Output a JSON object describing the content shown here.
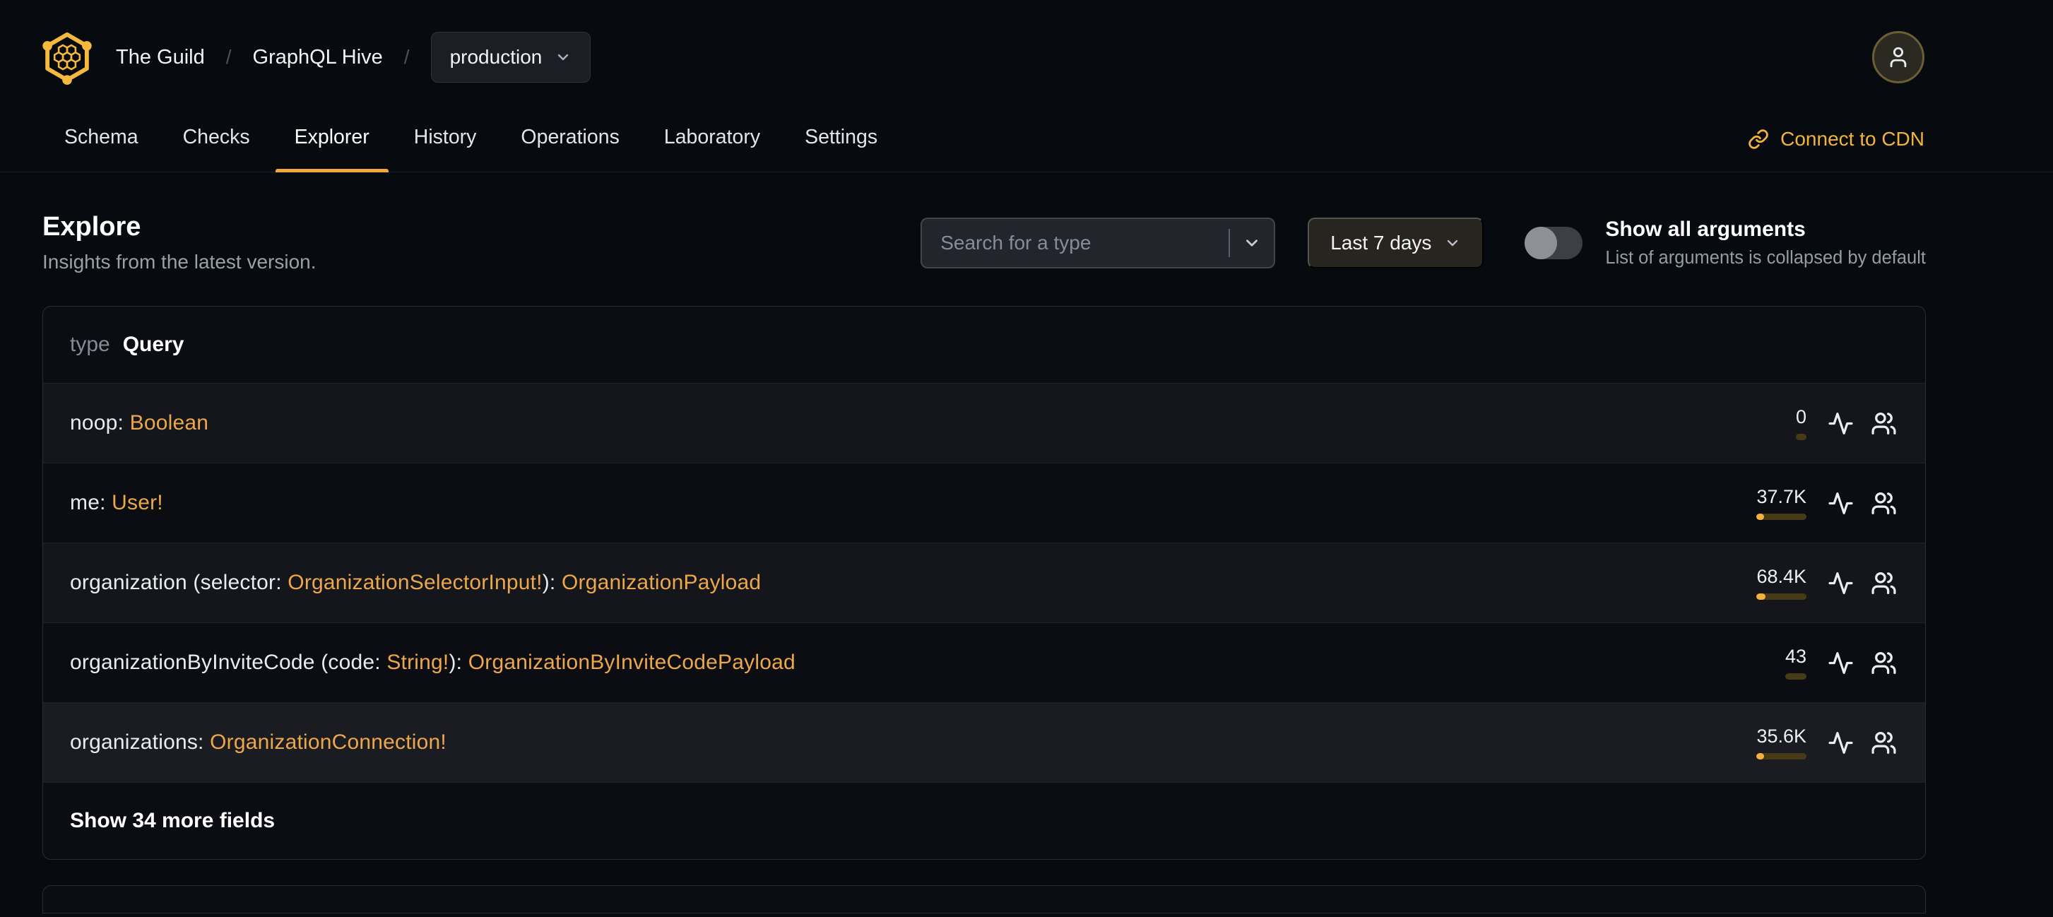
{
  "colors": {
    "accent": "#f4b13f",
    "type_link": "#eca74b",
    "bar_track": "#463b16",
    "bar_fill": "#f2b13d",
    "page_bg": "#070a0f",
    "card_bg": "#0b0d12"
  },
  "icons": {
    "logo": "hive-honeycomb-hexagon",
    "avatar": "person",
    "dropdown": "chevron-down",
    "cdn": "chain-link",
    "requests": "activity-pulse",
    "clients": "users-group"
  },
  "header": {
    "breadcrumb": {
      "org": "The Guild",
      "sep1": "/",
      "project": "GraphQL Hive",
      "sep2": "/",
      "target": "production"
    },
    "tabs": [
      {
        "label": "Schema",
        "active": false
      },
      {
        "label": "Checks",
        "active": false
      },
      {
        "label": "Explorer",
        "active": true
      },
      {
        "label": "History",
        "active": false
      },
      {
        "label": "Operations",
        "active": false
      },
      {
        "label": "Laboratory",
        "active": false
      },
      {
        "label": "Settings",
        "active": false
      }
    ],
    "cdn_label": "Connect to CDN"
  },
  "toolbar": {
    "title": "Explore",
    "subtitle": "Insights from the latest version.",
    "search_placeholder": "Search for a type",
    "period": "Last 7 days",
    "arguments_toggle": {
      "label": "Show all arguments",
      "hint": "List of arguments is collapsed by default",
      "state": "off"
    }
  },
  "type_card": {
    "kind_label": "type",
    "type_name": "Query",
    "fields": [
      {
        "segments": [
          {
            "text": "noop: ",
            "kind": "plain"
          },
          {
            "text": "Boolean",
            "kind": "type"
          }
        ],
        "count": "0",
        "fill_pct": 0,
        "highlight": false
      },
      {
        "segments": [
          {
            "text": "me: ",
            "kind": "plain"
          },
          {
            "text": "User!",
            "kind": "type"
          }
        ],
        "count": "37.7K",
        "fill_pct": 15,
        "highlight": false
      },
      {
        "segments": [
          {
            "text": "organization (selector: ",
            "kind": "plain"
          },
          {
            "text": "OrganizationSelectorInput!",
            "kind": "type"
          },
          {
            "text": "): ",
            "kind": "plain"
          },
          {
            "text": "OrganizationPayload",
            "kind": "type"
          }
        ],
        "count": "68.4K",
        "fill_pct": 18,
        "highlight": false
      },
      {
        "segments": [
          {
            "text": "organizationByInviteCode (code: ",
            "kind": "plain"
          },
          {
            "text": "String!",
            "kind": "type"
          },
          {
            "text": "): ",
            "kind": "plain"
          },
          {
            "text": "OrganizationByInviteCodePayload",
            "kind": "type"
          }
        ],
        "count": "43",
        "fill_pct": 0,
        "highlight": false
      },
      {
        "segments": [
          {
            "text": "organizations: ",
            "kind": "plain"
          },
          {
            "text": "OrganizationConnection!",
            "kind": "type"
          }
        ],
        "count": "35.6K",
        "fill_pct": 15,
        "highlight": true
      }
    ],
    "show_more_label": "Show 34 more fields"
  }
}
